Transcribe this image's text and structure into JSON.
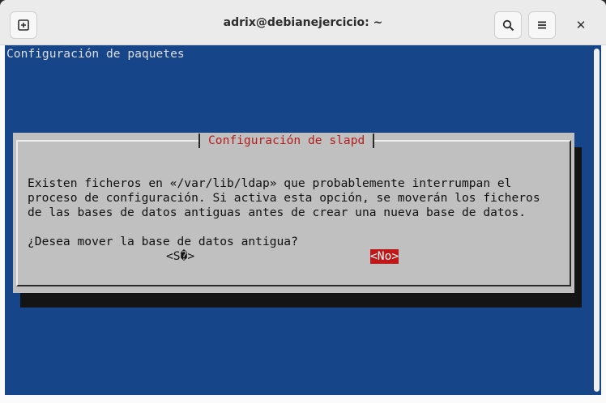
{
  "window": {
    "title": "adrix@debianejercicio: ~",
    "icons": {
      "new_tab": "new-tab-icon",
      "search": "search-icon",
      "menu": "hamburger-menu-icon",
      "close": "close-icon"
    },
    "close_glyph": "✕"
  },
  "terminal": {
    "header": "Configuración de paquetes",
    "background": "#17458a"
  },
  "dialog": {
    "title": "Configuración de slapd",
    "lines": [
      "Existen ficheros en «/var/lib/ldap» que probablemente interrumpan el",
      "proceso de configuración. Si activa esta opción, se moverán los ficheros",
      "de las bases de datos antiguas antes de crear una nueva base de datos.",
      "",
      "¿Desea mover la base de datos antigua?"
    ],
    "yes_label": "<S�>",
    "no_label": "<No>",
    "title_color": "#b31d1d",
    "selected_color": "#c01818"
  }
}
